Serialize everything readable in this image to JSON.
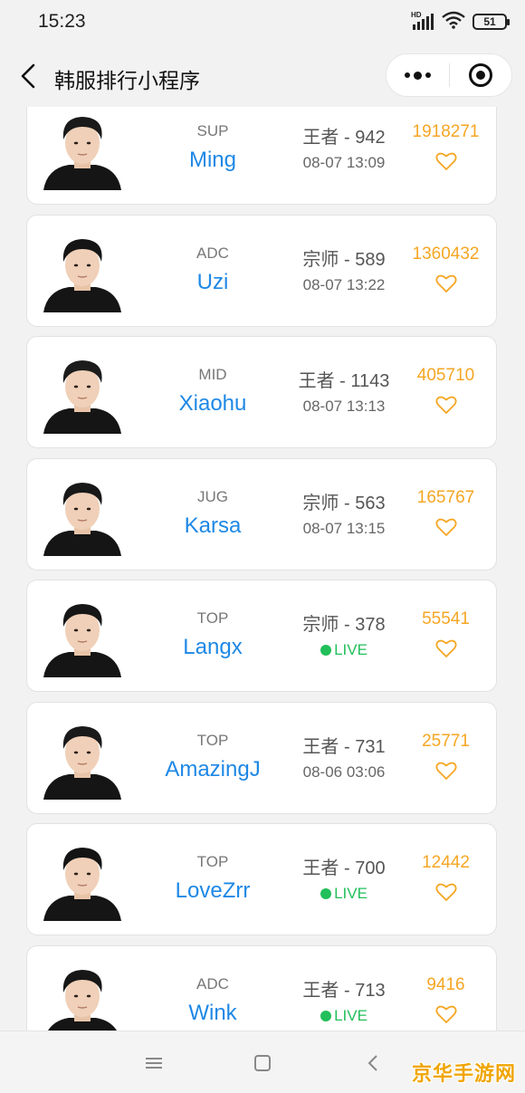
{
  "status": {
    "time": "15:23",
    "battery": "51",
    "hd": "HD"
  },
  "nav": {
    "title": "韩服排行小程序"
  },
  "colors": {
    "name": "#1e88e5",
    "score": "#f5a623",
    "live": "#22bf5a"
  },
  "players": [
    {
      "position": "SUP",
      "name": "Ming",
      "rank": "王者 - 942",
      "time": "08-07 13:09",
      "live": false,
      "score": "1918271"
    },
    {
      "position": "ADC",
      "name": "Uzi",
      "rank": "宗师 - 589",
      "time": "08-07 13:22",
      "live": false,
      "score": "1360432"
    },
    {
      "position": "MID",
      "name": "Xiaohu",
      "rank": "王者 - 1143",
      "time": "08-07 13:13",
      "live": false,
      "score": "405710"
    },
    {
      "position": "JUG",
      "name": "Karsa",
      "rank": "宗师 - 563",
      "time": "08-07 13:15",
      "live": false,
      "score": "165767"
    },
    {
      "position": "TOP",
      "name": "Langx",
      "rank": "宗师 - 378",
      "time": "LIVE",
      "live": true,
      "score": "55541"
    },
    {
      "position": "TOP",
      "name": "AmazingJ",
      "rank": "王者 - 731",
      "time": "08-06 03:06",
      "live": false,
      "score": "25771"
    },
    {
      "position": "TOP",
      "name": "LoveZrr",
      "rank": "王者 - 700",
      "time": "LIVE",
      "live": true,
      "score": "12442"
    },
    {
      "position": "ADC",
      "name": "Wink",
      "rank": "王者 - 713",
      "time": "LIVE",
      "live": true,
      "score": "9416"
    }
  ],
  "watermark": "京华手游网"
}
